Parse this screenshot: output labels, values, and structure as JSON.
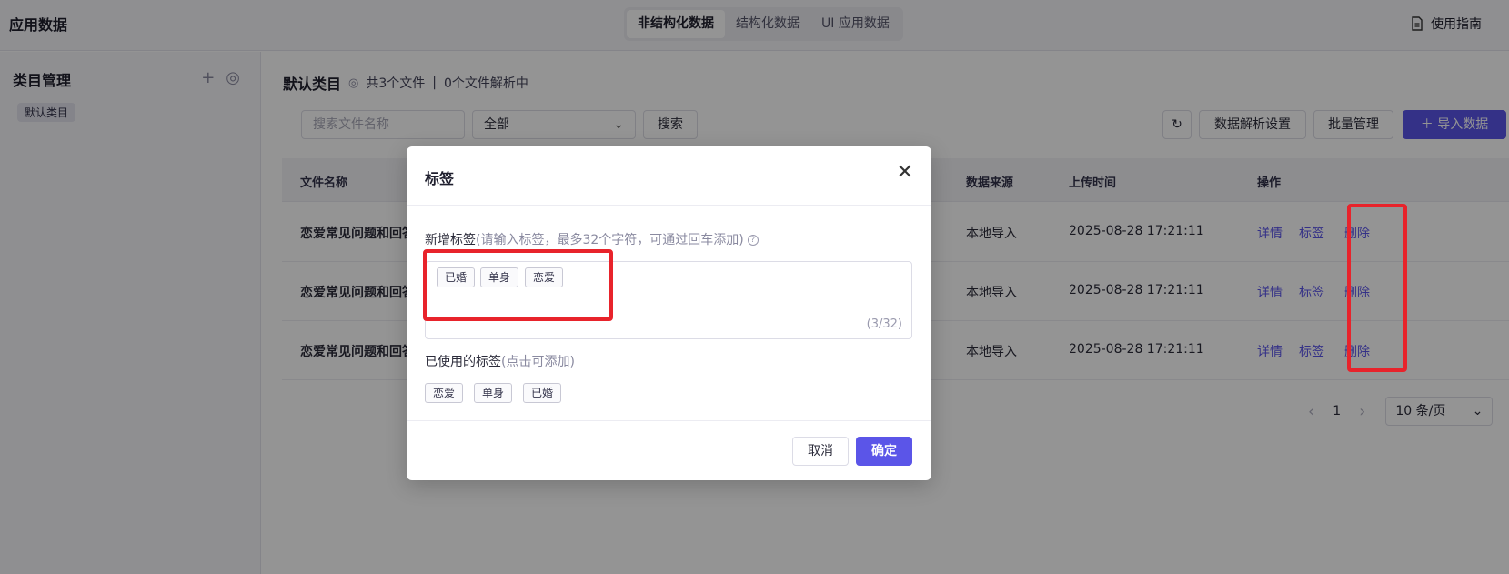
{
  "header": {
    "app_title": "应用数据",
    "tabs": [
      {
        "label": "非结构化数据",
        "active": true
      },
      {
        "label": "结构化数据",
        "active": false
      },
      {
        "label": "UI 应用数据",
        "active": false
      }
    ],
    "guide_label": "使用指南"
  },
  "sidebar": {
    "title": "类目管理",
    "add_icon": "plus-icon",
    "settings_icon": "settings-icon",
    "category": "默认类目"
  },
  "main": {
    "title": "默认类目",
    "file_info": "共3个文件",
    "separator": "|",
    "parsing_info": "0个文件解析中",
    "search_placeholder": "搜索文件名称",
    "filter_value": "全部",
    "search_button": "搜索",
    "refresh_icon": "refresh-icon",
    "parse_settings_button": "数据解析设置",
    "batch_button": "批量管理",
    "import_button": "导入数据",
    "accent_color": "#5b55e8"
  },
  "table": {
    "headers": {
      "name": "文件名称",
      "source": "数据来源",
      "time": "上传时间",
      "action": "操作"
    },
    "rows": [
      {
        "name": "恋爱常见问题和回答",
        "source": "本地导入",
        "time": "2025-08-28 17:21:11",
        "detail": "详情",
        "tag": "标签",
        "delete": "删除"
      },
      {
        "name": "恋爱常见问题和回答",
        "source": "本地导入",
        "time": "2025-08-28 17:21:11",
        "detail": "详情",
        "tag": "标签",
        "delete": "删除"
      },
      {
        "name": "恋爱常见问题和回答",
        "source": "本地导入",
        "time": "2025-08-28 17:21:11",
        "detail": "详情",
        "tag": "标签",
        "delete": "删除"
      }
    ]
  },
  "pagination": {
    "prev": "‹",
    "page": "1",
    "next": "›",
    "page_size": "10 条/页"
  },
  "modal": {
    "title": "标签",
    "new_label": "新增标签",
    "new_hint": "(请输入标签，最多32个字符，可通过回车添加)",
    "input_tags": [
      "已婚",
      "单身",
      "恋爱"
    ],
    "counter": "(3/32)",
    "used_label": "已使用的标签",
    "used_hint": "(点击可添加)",
    "used_tags": [
      "恋爱",
      "单身",
      "已婚"
    ],
    "cancel": "取消",
    "confirm": "确定"
  }
}
